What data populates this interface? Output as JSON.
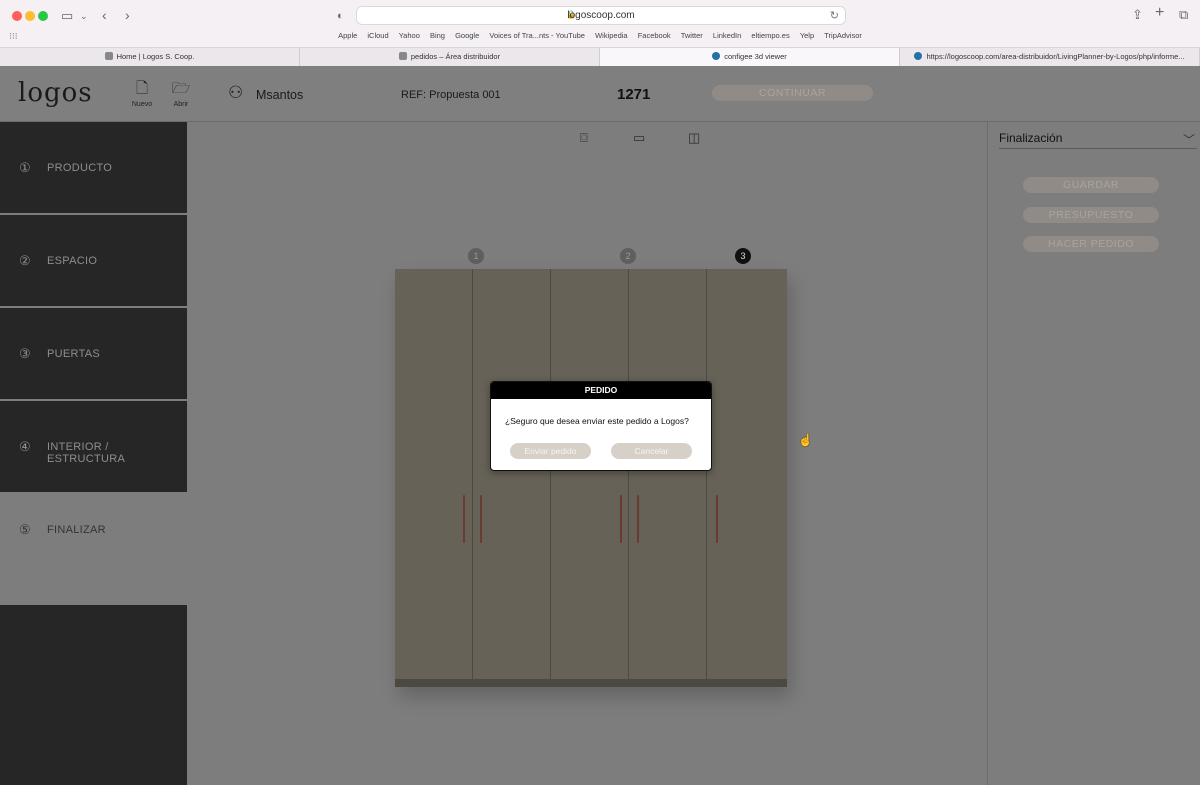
{
  "browser": {
    "url": "logoscoop.com",
    "bookmarks": [
      "Apple",
      "iCloud",
      "Yahoo",
      "Bing",
      "Google",
      "Voices of Tra...nts - YouTube",
      "Wikipedia",
      "Facebook",
      "Twitter",
      "LinkedIn",
      "eltiempo.es",
      "Yelp",
      "TripAdvisor"
    ],
    "tabs": [
      {
        "title": "Home | Logos S. Coop."
      },
      {
        "title": "pedidos – Área distribuidor"
      },
      {
        "title": "configee 3d viewer"
      },
      {
        "title": "https://logoscoop.com/area-distribuidor/LivingPlanner-by-Logos/php/informe..."
      }
    ]
  },
  "header": {
    "logo": "logos",
    "new_label": "Nuevo",
    "open_label": "Abrir",
    "username": "Msantos",
    "reference": "REF: Propuesta 001",
    "total": "1271",
    "continue_label": "CONTINUAR"
  },
  "sidebar": {
    "steps": [
      {
        "num": "①",
        "label": "PRODUCTO"
      },
      {
        "num": "②",
        "label": "ESPACIO"
      },
      {
        "num": "③",
        "label": "PUERTAS"
      },
      {
        "num": "④",
        "label": "INTERIOR / ESTRUCTURA"
      },
      {
        "num": "⑤",
        "label": "FINALIZAR"
      }
    ]
  },
  "canvas": {
    "modules": [
      "1",
      "2",
      "3"
    ]
  },
  "right_panel": {
    "section_title": "Finalización",
    "save_label": "GUARDAR",
    "budget_label": "PRESUPUESTO",
    "order_label": "HACER PEDIDO"
  },
  "modal": {
    "title": "PEDIDO",
    "message": "¿Seguro que desea enviar este pedido a Logos?",
    "confirm_label": "Enviar pedido",
    "cancel_label": "Cancelar"
  },
  "colors": {
    "sidebar_dark": "#262626",
    "modal_header": "#000000",
    "button_beige": "#d7d0c9"
  }
}
